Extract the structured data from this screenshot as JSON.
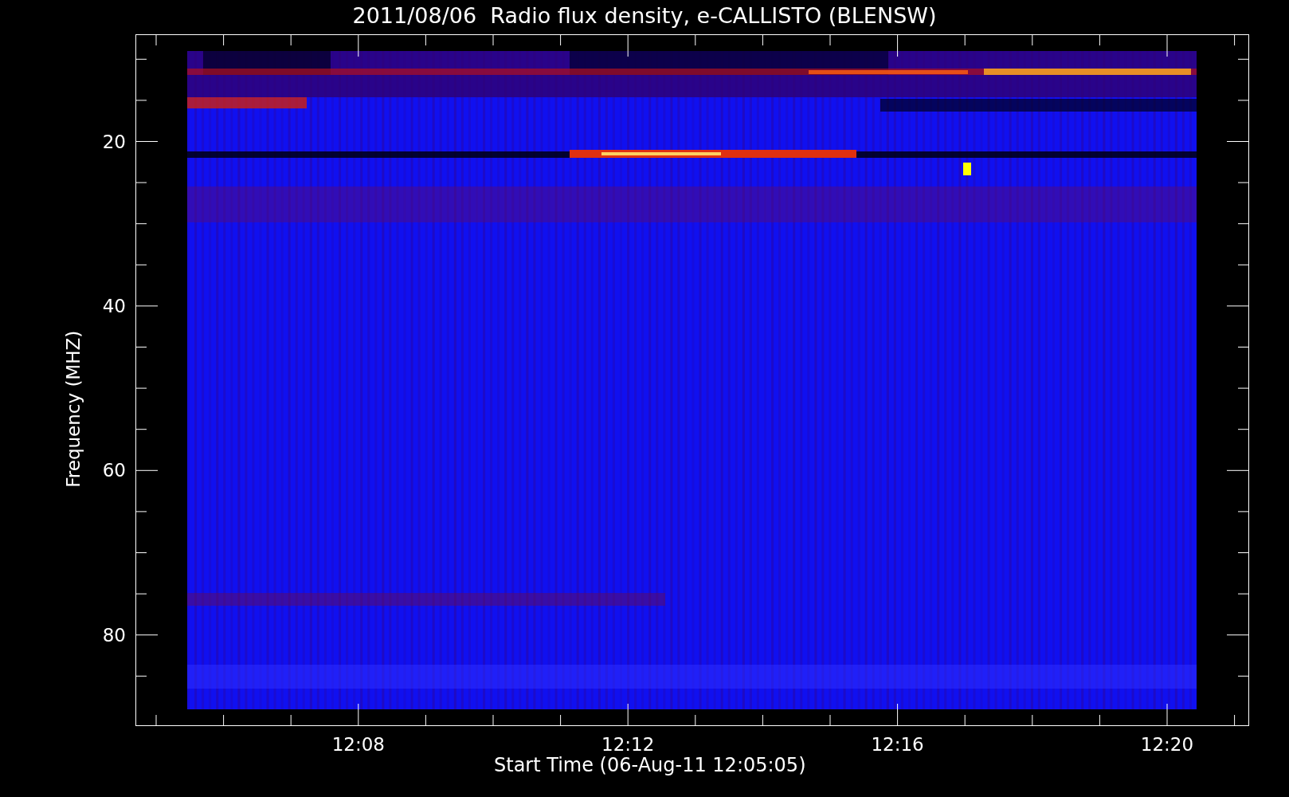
{
  "title": "2011/08/06  Radio flux density, e-CALLISTO (BLENSW)",
  "y_axis": {
    "label": "Frequency (MHZ)",
    "ticks": [
      "20",
      "40",
      "60",
      "80"
    ]
  },
  "x_axis": {
    "label": "Start Time (06-Aug-11 12:05:05)",
    "ticks": [
      "12:08",
      "12:12",
      "12:16",
      "12:20"
    ]
  }
}
